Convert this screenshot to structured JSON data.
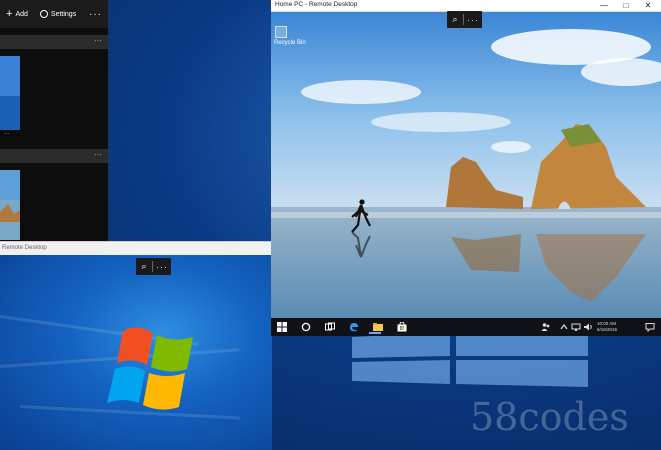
{
  "app": {
    "toolbar": {
      "add_label": "Add",
      "settings_label": "Settings",
      "more_label": "···"
    },
    "group_more_label": "···",
    "status_text": "Remote Desktop"
  },
  "rdp": {
    "title": "Home PC - Remote Desktop",
    "controls": {
      "minimize": "—",
      "maximize": "□",
      "close": "✕"
    },
    "desktop_icon_label": "Recycle Bin",
    "taskbar": {
      "time": "10:00 AM",
      "date": "6/16/2016"
    }
  },
  "zoom_controls": {
    "icon_label": "⌕",
    "more_label": "···"
  },
  "watermark": "58codes",
  "colors": {
    "win10_blue": "#0b3b86",
    "win7_blue": "#1463c2",
    "taskbar": "#101217"
  }
}
